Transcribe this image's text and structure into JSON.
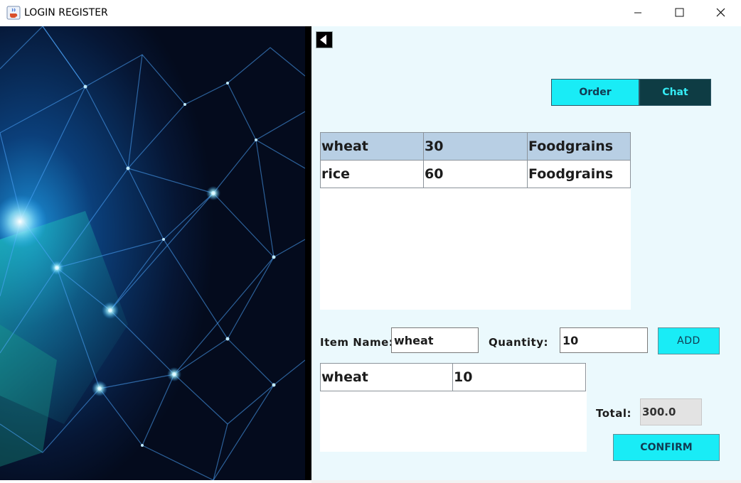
{
  "window": {
    "title": "LOGIN REGISTER",
    "icon": "java-coffee-icon",
    "controls": [
      "minimize-icon",
      "maximize-icon",
      "close-icon"
    ]
  },
  "colors": {
    "accent": "#19ecf6",
    "chat_tab_bg": "#0e3c44",
    "panel_bg": "#ebf9fd",
    "selected_row": "#b8cfe4"
  },
  "nav": {
    "back_icon": "triangle-left-icon",
    "tabs": [
      {
        "label": "Order"
      },
      {
        "label": "Chat"
      }
    ]
  },
  "products": {
    "rows": [
      {
        "name": "wheat",
        "qty": "30",
        "category": "Foodgrains",
        "selected": true
      },
      {
        "name": "rice",
        "qty": "60",
        "category": "Foodgrains",
        "selected": false
      }
    ]
  },
  "form": {
    "item_name_label": "Item Name:",
    "item_name_value": "wheat",
    "quantity_label": "Quantity:",
    "quantity_value": "10",
    "add_label": "ADD"
  },
  "cart": {
    "rows": [
      {
        "name": "wheat",
        "qty": "10"
      }
    ]
  },
  "summary": {
    "total_label": "Total:",
    "total_value": "300.0",
    "confirm_label": "CONFIRM"
  }
}
